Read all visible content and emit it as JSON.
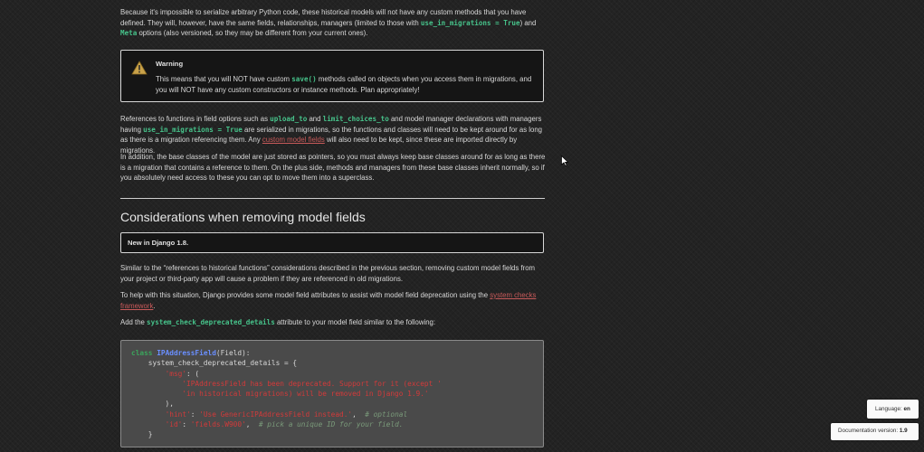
{
  "para1": {
    "t1": "Because it's impossible to serialize arbitrary Python code, these historical models will not have any custom methods that you have defined. They will, however, have the same fields, relationships, managers (limited to those with ",
    "c1": "use_in_migrations = True",
    "t2": ") and ",
    "c2": "Meta",
    "t3": " options (also versioned, so they may be different from your current ones)."
  },
  "warning": {
    "title": "Warning",
    "t1": "This means that you will NOT have custom ",
    "c1": "save()",
    "t2": " methods called on objects when you access them in migrations, and you will NOT have any custom constructors or instance methods. Plan appropriately!"
  },
  "para2": {
    "t1": "References to functions in field options such as ",
    "c1": "upload_to",
    "t2": " and ",
    "c2": "limit_choices_to",
    "t3": " and model manager declarations with managers having ",
    "c3": "use_in_migrations = True",
    "t4": " are serialized in migrations, so the functions and classes will need to be kept around for as long as there is a migration referencing them. Any ",
    "link": "custom model fields",
    "t5": " will also need to be kept, since these are imported directly by migrations."
  },
  "para3": "In addition, the base classes of the model are just stored as pointers, so you must always keep base classes around for as long as there is a migration that contains a reference to them. On the plus side, methods and managers from these base classes inherit normally, so if you absolutely need access to these you can opt to move them into a superclass.",
  "heading": "Considerations when removing model fields",
  "new_in": "New in Django 1.8.",
  "para4": "Similar to the “references to historical functions” considerations described in the previous section, removing custom model fields from your project or third-party app will cause a problem if they are referenced in old migrations.",
  "para5": {
    "t1": "To help with this situation, Django provides some model field attributes to assist with model field deprecation using the ",
    "link": "system checks framework",
    "t2": "."
  },
  "para6": {
    "t1": "Add the ",
    "c1": "system_check_deprecated_details",
    "t2": " attribute to your model field similar to the following:"
  },
  "code": {
    "kw_class": "class",
    "class_name": "IPAddressField",
    "base": "(Field):",
    "attr": "    system_check_deprecated_details = {",
    "msg_key": "'msg'",
    "msg_line1": "'IPAddressField has been deprecated. Support for it (except '",
    "msg_line2": "'in historical migrations) will be removed in Django 1.9.'",
    "close_paren": "        ),",
    "hint_key": "'hint'",
    "hint_val": "'Use GenericIPAddressField instead.'",
    "hint_comment": "# optional",
    "id_key": "'id'",
    "id_val": "'fields.W900'",
    "id_comment": "# pick a unique ID for your field.",
    "close_brace": "    }"
  },
  "badges": {
    "language_label": "Language:",
    "language_value": "en",
    "version_label": "Documentation version:",
    "version_value": "1.9"
  },
  "colors": {
    "background": "#232323",
    "code_green": "#46c28a",
    "link_red": "#c85a5a"
  }
}
